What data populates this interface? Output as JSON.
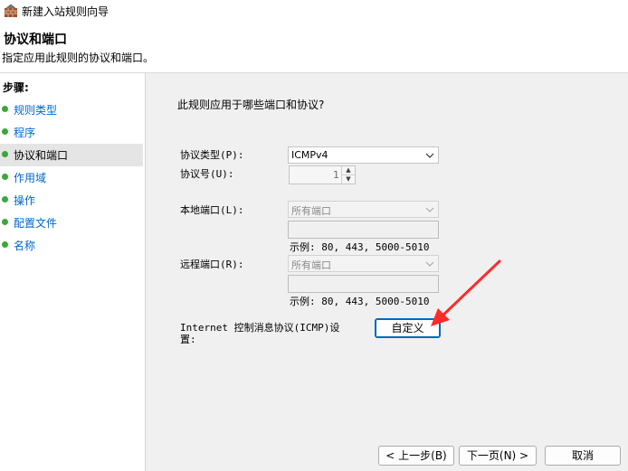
{
  "window": {
    "title": "新建入站规则向导",
    "icon": "firewall-brick-icon"
  },
  "header": {
    "title": "协议和端口",
    "subtitle": "指定应用此规则的协议和端口。"
  },
  "sidebar": {
    "heading": "步骤:",
    "items": [
      {
        "label": "规则类型",
        "active": false
      },
      {
        "label": "程序",
        "active": false
      },
      {
        "label": "协议和端口",
        "active": true
      },
      {
        "label": "作用域",
        "active": false
      },
      {
        "label": "操作",
        "active": false
      },
      {
        "label": "配置文件",
        "active": false
      },
      {
        "label": "名称",
        "active": false
      }
    ],
    "dot_color": "#3aa83a"
  },
  "main": {
    "question": "此规则应用于哪些端口和协议?",
    "protocol_type": {
      "label": "协议类型(P):",
      "value": "ICMPv4"
    },
    "protocol_number": {
      "label": "协议号(U):",
      "value": "1"
    },
    "local_port": {
      "label": "本地端口(L):",
      "value": "所有端口",
      "example": "示例: 80, 443, 5000-5010"
    },
    "remote_port": {
      "label": "远程端口(R):",
      "value": "所有端口",
      "example": "示例: 80, 443, 5000-5010"
    },
    "icmp": {
      "label_line1": "Internet 控制消息协议(ICMP)设",
      "label_line2": "置:",
      "button": "自定义"
    }
  },
  "footer": {
    "back": "< 上一步(B)",
    "next": "下一页(N) >",
    "cancel": "取消"
  },
  "colors": {
    "accent": "#0067c0",
    "link": "#0066cc",
    "annotation_arrow": "#ff2a2a"
  }
}
